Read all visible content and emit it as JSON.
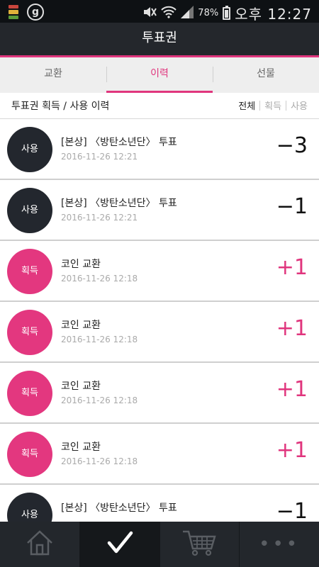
{
  "status_bar": {
    "battery": "78%",
    "time": "오후 12:27"
  },
  "app_bar": {
    "title": "투표권"
  },
  "tabs": [
    {
      "label": "교환"
    },
    {
      "label": "이력"
    },
    {
      "label": "선물"
    }
  ],
  "history": {
    "title": "투표권 획득 / 사용 이력",
    "filters": [
      "전체",
      "획득",
      "사용"
    ]
  },
  "rows": [
    {
      "badge": "사용",
      "title": "[본상] 〈방탄소년단〉 투표",
      "time": "2016-11-26 12:21",
      "amount": "−3"
    },
    {
      "badge": "사용",
      "title": "[본상] 〈방탄소년단〉 투표",
      "time": "2016-11-26 12:21",
      "amount": "−1"
    },
    {
      "badge": "획득",
      "title": "코인 교환",
      "time": "2016-11-26 12:18",
      "amount": "+1"
    },
    {
      "badge": "획득",
      "title": "코인 교환",
      "time": "2016-11-26 12:18",
      "amount": "+1"
    },
    {
      "badge": "획득",
      "title": "코인 교환",
      "time": "2016-11-26 12:18",
      "amount": "+1"
    },
    {
      "badge": "획득",
      "title": "코인 교환",
      "time": "2016-11-26 12:18",
      "amount": "+1"
    },
    {
      "badge": "사용",
      "title": "[본상] 〈방탄소년단〉 투표",
      "time": "",
      "amount": "−1"
    }
  ],
  "bottom_nav": [
    {
      "icon": "home-icon"
    },
    {
      "icon": "check-icon"
    },
    {
      "icon": "cart-icon"
    },
    {
      "icon": "more-icon"
    }
  ],
  "colors": {
    "accent": "#e0357d",
    "dark": "#24272c",
    "use_badge": "#23272e",
    "get_badge": "#e3377f"
  }
}
